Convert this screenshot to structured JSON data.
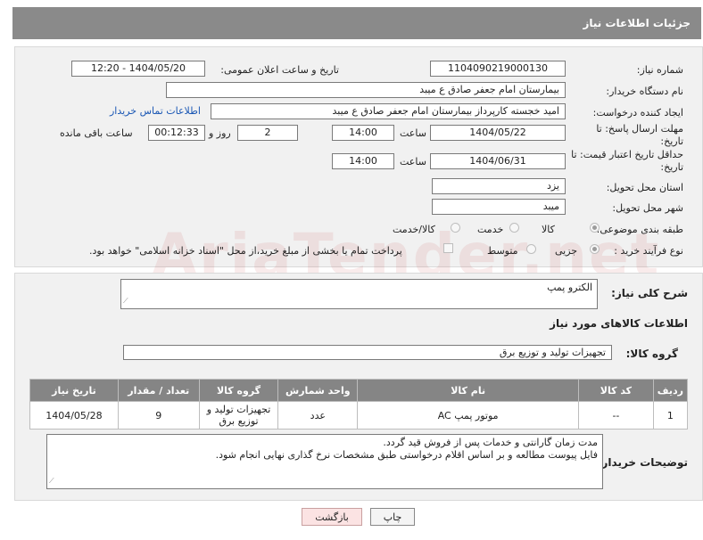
{
  "header": {
    "title": "جزئیات اطلاعات نیاز"
  },
  "form": {
    "need_number_label": "شماره نیاز:",
    "need_number": "1104090219000130",
    "announce_label": "تاریخ و ساعت اعلان عمومی:",
    "announce_value": "1404/05/20 - 12:20",
    "buyer_org_label": "نام دستگاه خریدار:",
    "buyer_org": "بیمارستان امام جعفر صادق  ع  میبد",
    "creator_label": "ایجاد کننده درخواست:",
    "creator": "امید خجسته کارپرداز بیمارستان امام جعفر صادق  ع  میبد",
    "contact_link": "اطلاعات تماس خریدار",
    "reply_deadline_label": "مهلت ارسال پاسخ: تا تاریخ:",
    "reply_date": "1404/05/22",
    "time_label": "ساعت",
    "reply_time": "14:00",
    "days_value": "2",
    "days_label": "روز و",
    "remaining_value": "00:12:33",
    "remaining_label": "ساعت باقی مانده",
    "price_validity_label": "حداقل تاریخ اعتبار قیمت: تا تاریخ:",
    "price_date": "1404/06/31",
    "price_time": "14:00",
    "province_label": "استان محل تحویل:",
    "province": "یزد",
    "city_label": "شهر محل تحویل:",
    "city": "میبد",
    "category_label": "طبقه بندی موضوعی:",
    "category_options": [
      "کالا",
      "خدمت",
      "کالا/خدمت"
    ],
    "process_label": "نوع فرآیند خرید :",
    "process_options": [
      "جزیی",
      "متوسط"
    ],
    "payment_note": "پرداخت تمام یا بخشی از مبلغ خرید،از محل \"اسناد خزانه اسلامی\" خواهد بود."
  },
  "details": {
    "summary_label": "شرح کلی نیاز:",
    "summary": "الکترو پمپ",
    "goods_info_title": "اطلاعات کالاهای مورد نیاز",
    "goods_group_label": "گروه کالا:",
    "goods_group": "تجهیزات تولید و توزیع برق",
    "table": {
      "headers": [
        "ردیف",
        "کد کالا",
        "نام کالا",
        "واحد شمارش",
        "گروه کالا",
        "تعداد / مقدار",
        "تاریخ نیاز"
      ],
      "rows": [
        [
          "1",
          "--",
          "موتور پمپ AC",
          "عدد",
          "تجهیزات تولید و توزیع برق",
          "9",
          "1404/05/28"
        ]
      ]
    },
    "buyer_notes_label": "توضیحات خریدار:",
    "buyer_notes_line1": "مدت زمان گارانتی و خدمات پس از فروش قید گردد.",
    "buyer_notes_line2": "فایل پیوست مطالعه و بر اساس اقلام درخواستی طبق مشخصات نرخ گذاری نهایی انجام شود."
  },
  "buttons": {
    "print": "چاپ",
    "back": "بازگشت"
  },
  "watermark": "AriaTender.net",
  "colors": {
    "header_bg": "#8a8a8a",
    "link": "#1a57b4",
    "back_btn_bg": "#fbe3e3"
  }
}
